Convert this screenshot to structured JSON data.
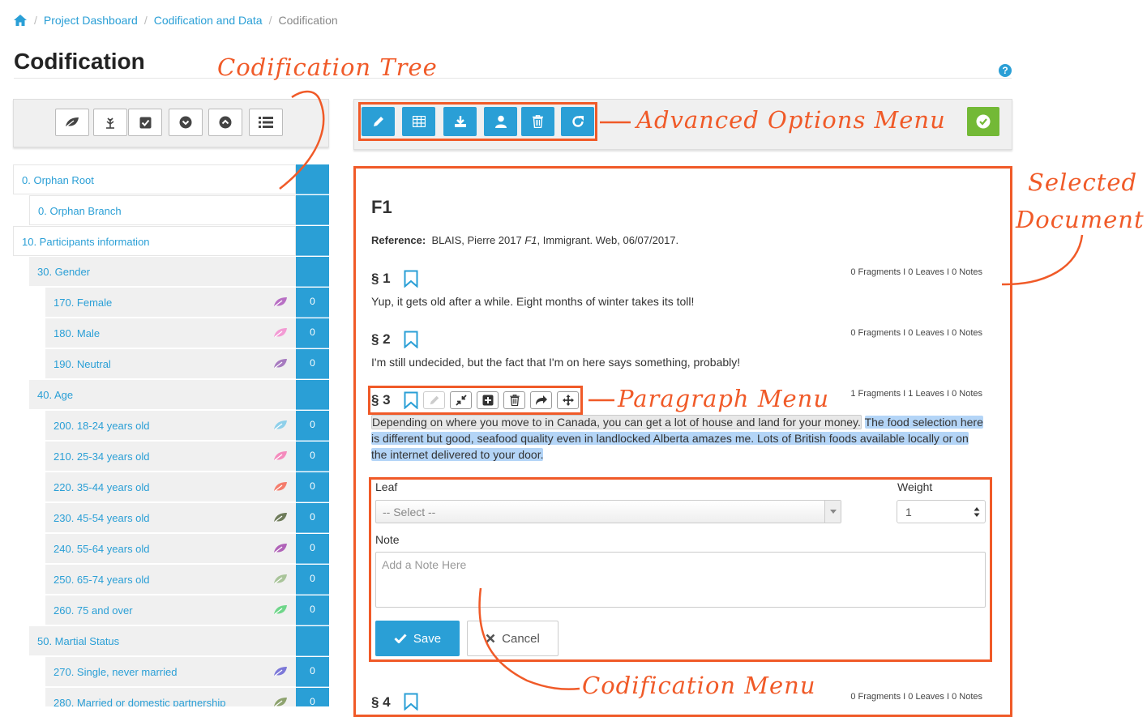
{
  "breadcrumb": {
    "items": [
      "Project Dashboard",
      "Codification and Data",
      "Codification"
    ]
  },
  "page": {
    "title": "Codification",
    "help": "?"
  },
  "tree": {
    "rows": [
      {
        "label": "0. Orphan Root",
        "count": ""
      },
      {
        "label": "0. Orphan Branch",
        "count": ""
      },
      {
        "label": "10. Participants information",
        "count": ""
      },
      {
        "label": "30. Gender",
        "count": ""
      },
      {
        "label": "170. Female",
        "count": "0",
        "leaf_color": "#b86fc4"
      },
      {
        "label": "180. Male",
        "count": "0",
        "leaf_color": "#f39bd4"
      },
      {
        "label": "190. Neutral",
        "count": "0",
        "leaf_color": "#a77bc0"
      },
      {
        "label": "40. Age",
        "count": ""
      },
      {
        "label": "200. 18-24 years old",
        "count": "0",
        "leaf_color": "#8fd0ea"
      },
      {
        "label": "210. 25-34 years old",
        "count": "0",
        "leaf_color": "#f48bbd"
      },
      {
        "label": "220. 35-44 years old",
        "count": "0",
        "leaf_color": "#f47c6c"
      },
      {
        "label": "230. 45-54 years old",
        "count": "0",
        "leaf_color": "#6e7b5a"
      },
      {
        "label": "240. 55-64 years old",
        "count": "0",
        "leaf_color": "#b063b8"
      },
      {
        "label": "250. 65-74 years old",
        "count": "0",
        "leaf_color": "#a9c49a"
      },
      {
        "label": "260. 75 and over",
        "count": "0",
        "leaf_color": "#6fd68a"
      },
      {
        "label": "50. Martial Status",
        "count": ""
      },
      {
        "label": "270. Single, never married",
        "count": "0",
        "leaf_color": "#7c78d8"
      },
      {
        "label": "280. Married or domestic partnership",
        "count": "0",
        "leaf_color": "#8ea36f"
      }
    ]
  },
  "document": {
    "title": "F1",
    "reference_label": "Reference:",
    "reference_pre": "BLAIS, Pierre 2017 ",
    "reference_italic": "F1",
    "reference_post": ", Immigrant. Web, 06/07/2017.",
    "paragraphs": [
      {
        "head": "§  1",
        "stats": "0 Fragments I 0 Leaves I 0 Notes",
        "text": "Yup, it gets old after a while. Eight months of winter takes its toll!"
      },
      {
        "head": "§  2",
        "stats": "0 Fragments I 0 Leaves I 0 Notes",
        "text": "I'm still undecided, but the fact that I'm on here says something, probably!"
      },
      {
        "head": "§  3",
        "stats": "1 Fragments I 1 Leaves I 0 Notes",
        "text_grey": "Depending on where you move to in Canada, you can get a lot of house and land for your money.",
        "text_blue_1": "The food selection here",
        "text_blue_2": "is different but good, seafood quality even in landlocked Alberta amazes me. Lots of British foods available locally or on",
        "text_blue_3": "the internet delivered to your door."
      },
      {
        "head": "§  4",
        "stats": "0 Fragments I 0 Leaves I 0 Notes"
      }
    ]
  },
  "form": {
    "leaf_label": "Leaf",
    "leaf_value": "-- Select --",
    "weight_label": "Weight",
    "weight_value": "1",
    "note_label": "Note",
    "note_placeholder": "Add a Note Here",
    "save": "Save",
    "cancel": "Cancel"
  },
  "annotations": {
    "tree": "Codification Tree",
    "advanced": "Advanced Options Menu",
    "selected_1": "Selected",
    "selected_2": "Document",
    "paragraph": "Paragraph Menu",
    "codification": "Codification Menu"
  },
  "colors": {
    "accent": "#2a9fd6",
    "annotation": "#f05a28",
    "success": "#73b936"
  }
}
